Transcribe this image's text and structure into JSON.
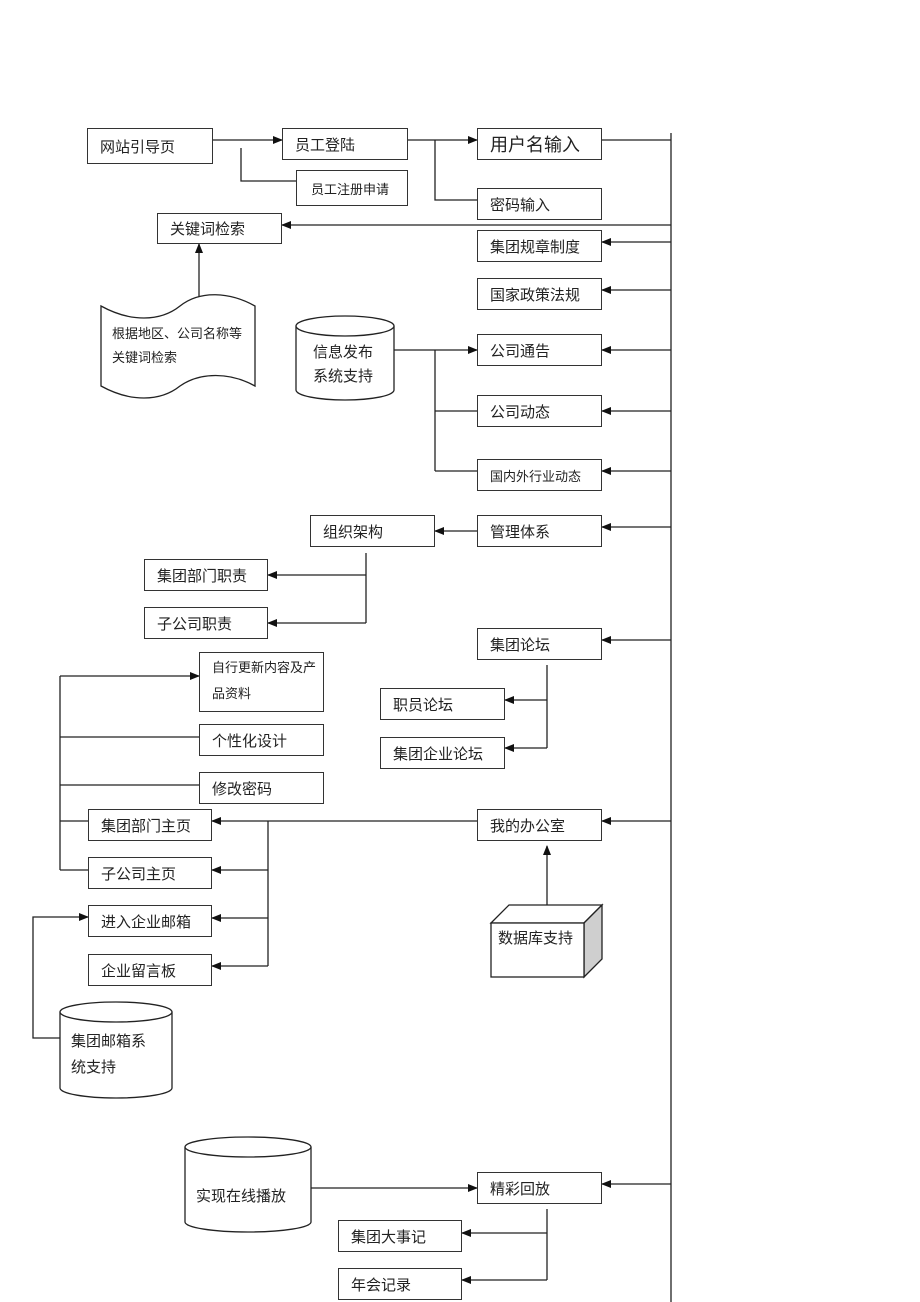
{
  "diagram": {
    "type": "flowchart",
    "nodes": {
      "guide_page": "网站引导页",
      "staff_login": "员工登陆",
      "staff_register": "员工注册申请",
      "username_input": "用户名输入",
      "password_input": "密码输入",
      "keyword_search": "关键词检索",
      "search_note": "根据地区、公司名称等关键词检索",
      "group_rules": "集团规章制度",
      "national_policy": "国家政策法规",
      "info_publish_support": "信息发布系统支持",
      "company_notice": "公司通告",
      "company_news": "公司动态",
      "industry_news": "国内外行业动态",
      "org_structure": "组织架构",
      "management_system": "管理体系",
      "group_dept_duties": "集团部门职责",
      "subsidiary_duties": "子公司职责",
      "group_forum": "集团论坛",
      "staff_forum": "职员论坛",
      "enterprise_forum": "集团企业论坛",
      "self_update": "自行更新内容及产品资料",
      "personalize": "个性化设计",
      "change_password": "修改密码",
      "group_dept_home": "集团部门主页",
      "subsidiary_home": "子公司主页",
      "enter_mailbox": "进入企业邮箱",
      "message_board": "企业留言板",
      "my_office": "我的办公室",
      "database_support": "数据库支持",
      "mail_system_support": "集团邮箱系统支持",
      "online_play": "实现在线播放",
      "highlights_replay": "精彩回放",
      "group_events": "集团大事记",
      "annual_meeting": "年会记录"
    },
    "edges": [
      [
        "guide_page",
        "staff_login"
      ],
      [
        "guide_page",
        "staff_register"
      ],
      [
        "staff_login",
        "username_input"
      ],
      [
        "staff_login",
        "password_input"
      ],
      [
        "spine",
        "keyword_search"
      ],
      [
        "search_note",
        "keyword_search"
      ],
      [
        "spine",
        "group_rules"
      ],
      [
        "spine",
        "national_policy"
      ],
      [
        "info_publish_support",
        "company_notice"
      ],
      [
        "info_publish_support",
        "company_news"
      ],
      [
        "info_publish_support",
        "industry_news"
      ],
      [
        "spine",
        "company_notice"
      ],
      [
        "spine",
        "company_news"
      ],
      [
        "spine",
        "industry_news"
      ],
      [
        "spine",
        "management_system"
      ],
      [
        "management_system",
        "org_structure"
      ],
      [
        "org_structure",
        "group_dept_duties"
      ],
      [
        "org_structure",
        "subsidiary_duties"
      ],
      [
        "spine",
        "group_forum"
      ],
      [
        "group_forum",
        "staff_forum"
      ],
      [
        "group_forum",
        "enterprise_forum"
      ],
      [
        "spine",
        "my_office"
      ],
      [
        "database_support",
        "my_office"
      ],
      [
        "my_office",
        "group_dept_home"
      ],
      [
        "my_office",
        "subsidiary_home"
      ],
      [
        "my_office",
        "enter_mailbox"
      ],
      [
        "my_office",
        "message_board"
      ],
      [
        "group_dept_home",
        "self_update"
      ],
      [
        "mail_system_support",
        "enter_mailbox"
      ],
      [
        "spine",
        "highlights_replay"
      ],
      [
        "online_play",
        "highlights_replay"
      ],
      [
        "highlights_replay",
        "group_events"
      ],
      [
        "highlights_replay",
        "annual_meeting"
      ]
    ]
  }
}
